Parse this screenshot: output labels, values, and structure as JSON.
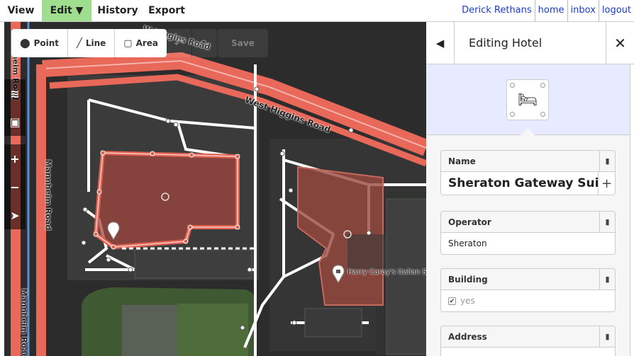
{
  "menu": {
    "view": "View",
    "edit": "Edit ▼",
    "history": "History",
    "export": "Export"
  },
  "user": {
    "name": "Derick Rethans",
    "home": "home",
    "inbox": "inbox",
    "logout": "logout"
  },
  "toolbar": {
    "point": "Point",
    "line": "Line",
    "area": "Area",
    "save": "Save"
  },
  "map_labels": {
    "road_a": "W Higgins Road",
    "road_b": "West Higgins Road",
    "road_c": "Mannheim Road",
    "road_d": "Mannheim Road",
    "road_e": "Mannheim Road",
    "poi": "Harry Caray's Italian S"
  },
  "sidebar": {
    "title": "Editing Hotel",
    "preset_icon": "bed-icon",
    "fields": {
      "name_label": "Name",
      "name_value": "Sheraton Gateway Suites",
      "operator_label": "Operator",
      "operator_value": "Sheraton",
      "building_label": "Building",
      "building_value": "yes",
      "address_label": "Address"
    }
  },
  "colors": {
    "edit_active": "#9fdd8f",
    "road_primary": "#e8685a",
    "area_selected": "#e06050",
    "sidebar_preset_bg": "#e8ebff",
    "link": "#1a3cc4"
  }
}
